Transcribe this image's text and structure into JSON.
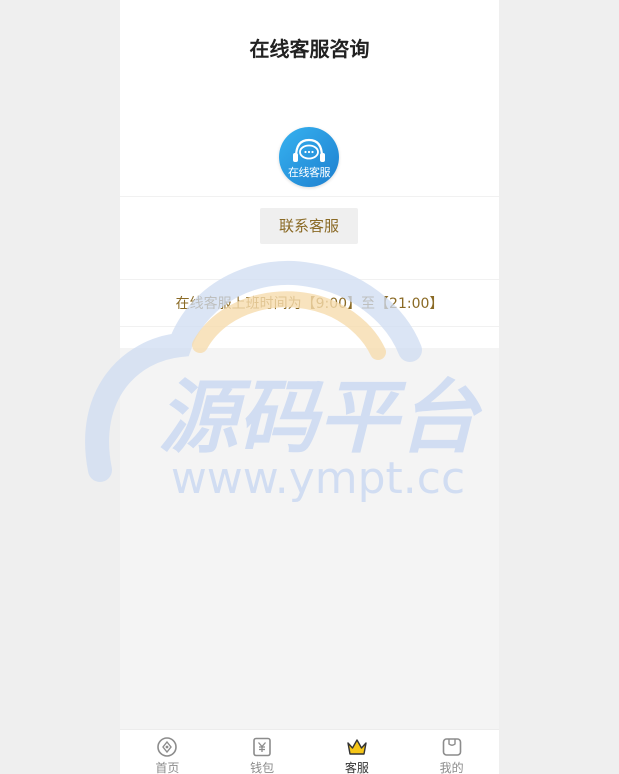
{
  "header": {
    "title": "在线客服咨询"
  },
  "service": {
    "avatar_label": "在线客服",
    "contact_button": "联系客服",
    "hours_text": "在线客服上班时间为【9:00】至【21:00】"
  },
  "watermark": {
    "brand": "源码平台",
    "url": "www.ympt.cc"
  },
  "tabbar": {
    "items": [
      {
        "label": "首页",
        "icon": "compass-icon",
        "active": false
      },
      {
        "label": "钱包",
        "icon": "wallet-yen-icon",
        "active": false
      },
      {
        "label": "客服",
        "icon": "crown-icon",
        "active": true
      },
      {
        "label": "我的",
        "icon": "user-bag-icon",
        "active": false
      }
    ]
  },
  "colors": {
    "accent_text": "#8a6a25",
    "active_icon": "#f5c518",
    "avatar_blue": "#2a95e0"
  }
}
